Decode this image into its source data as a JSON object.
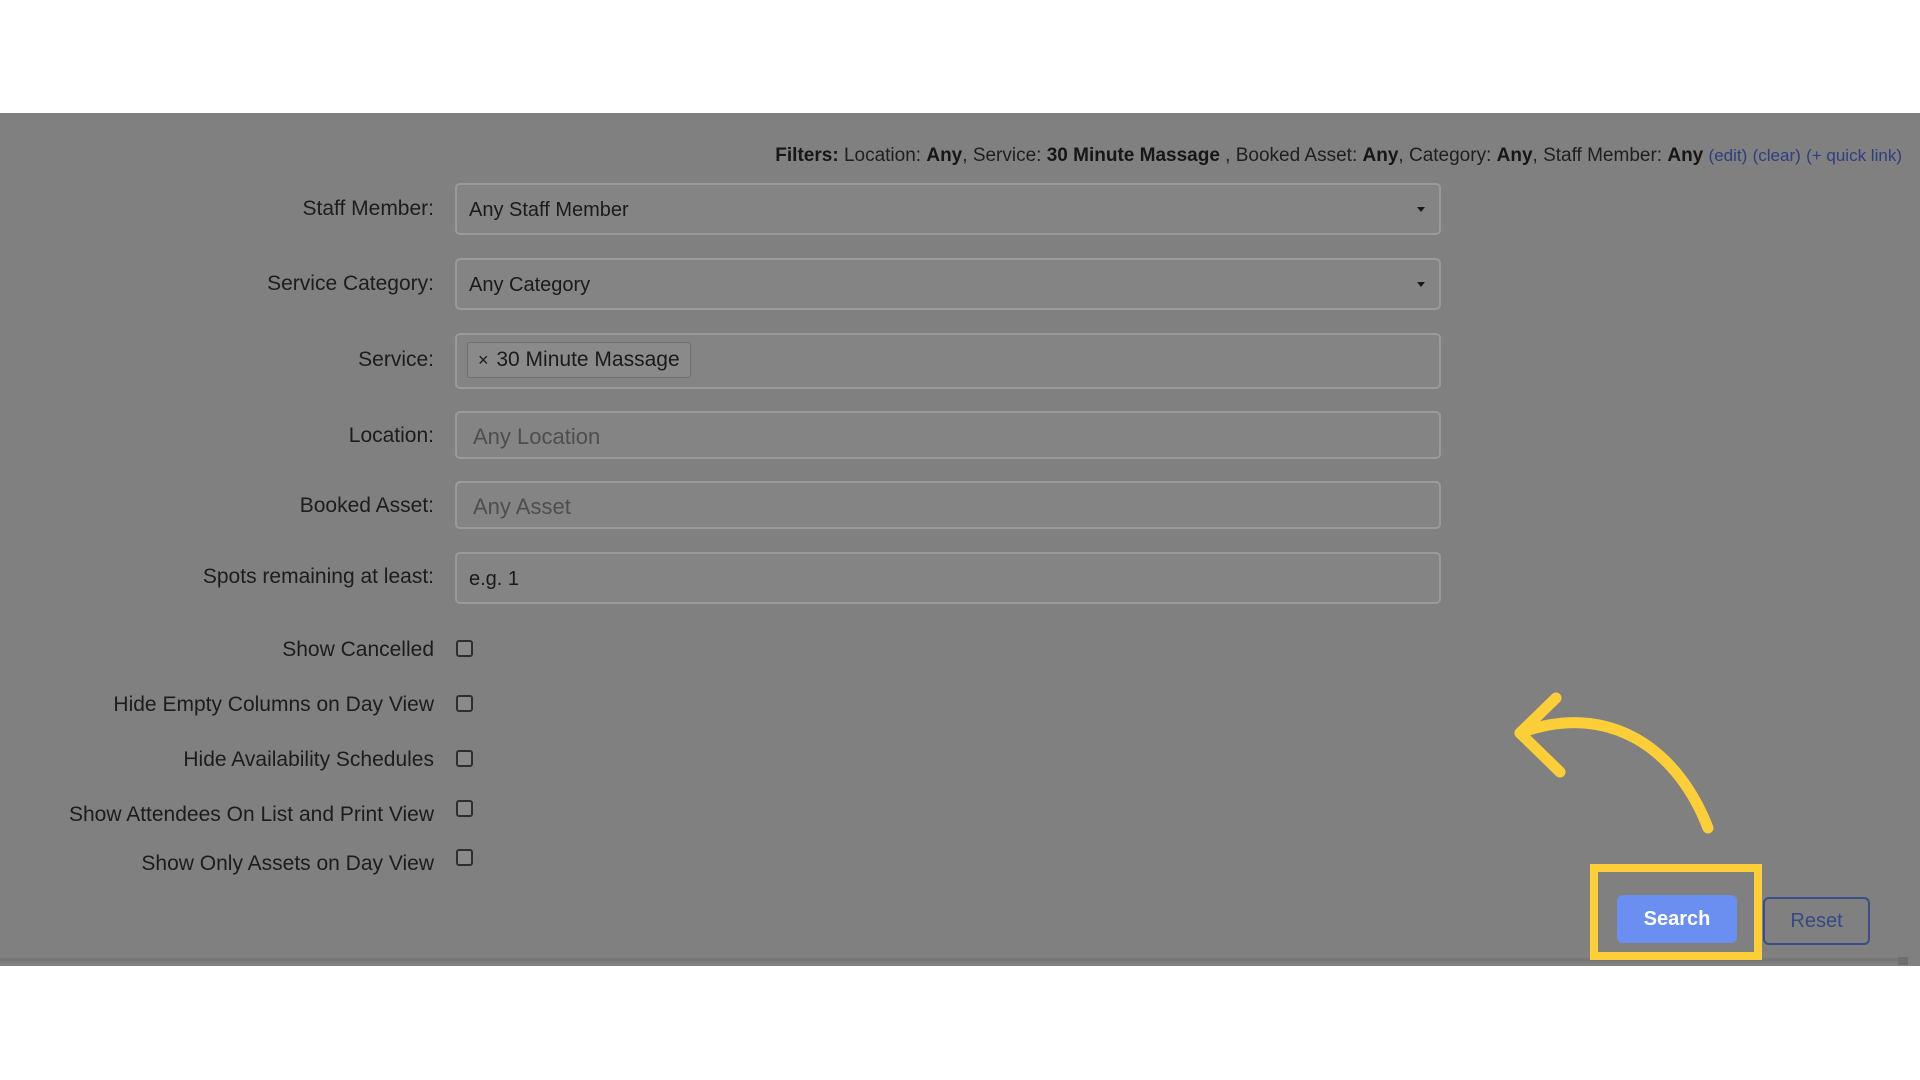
{
  "filters": {
    "prefix": "Filters:",
    "location_label": "Location:",
    "location_value": "Any",
    "service_label": "Service:",
    "service_value": "30 Minute Massage",
    "booked_asset_label": "Booked Asset:",
    "booked_asset_value": "Any",
    "category_label": "Category:",
    "category_value": "Any",
    "staff_label": "Staff Member:",
    "staff_value": "Any",
    "edit_link": "edit",
    "clear_link": "clear",
    "quick_link": "+ quick link"
  },
  "form": {
    "staff_member": {
      "label": "Staff Member:",
      "value": "Any Staff Member"
    },
    "service_category": {
      "label": "Service Category:",
      "value": "Any Category"
    },
    "service": {
      "label": "Service:",
      "chip_remove": "×",
      "chip": "30 Minute Massage"
    },
    "location": {
      "label": "Location:",
      "placeholder": "Any Location"
    },
    "booked_asset": {
      "label": "Booked Asset:",
      "placeholder": "Any Asset"
    },
    "spots_remaining": {
      "label": "Spots remaining at least:",
      "placeholder": "e.g. 1"
    }
  },
  "checkboxes": [
    {
      "label": "Show Cancelled",
      "checked": false
    },
    {
      "label": "Hide Empty Columns on Day View",
      "checked": false
    },
    {
      "label": "Hide Availability Schedules",
      "checked": false
    },
    {
      "label": "Show Attendees On List and Print View",
      "checked": false
    },
    {
      "label": "Show Only Assets on Day View",
      "checked": false
    }
  ],
  "buttons": {
    "search": "Search",
    "reset": "Reset"
  },
  "colors": {
    "highlight": "#fccf38",
    "search_button": "#6b8ff0",
    "overlay": "#808080"
  }
}
